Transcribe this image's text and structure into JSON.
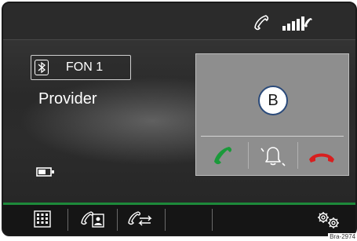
{
  "status_bar": {
    "phone_icon": "phone-handset-icon",
    "signal_icon": "signal-strength-icon"
  },
  "connection": {
    "device_label": "FON 1",
    "bluetooth_icon": "bluetooth-icon",
    "provider": "Provider",
    "battery_icon": "battery-icon"
  },
  "incoming_call": {
    "caller_initial": "B",
    "accept_icon": "accept-call-icon",
    "mute_ringtone_icon": "mute-ringtone-icon",
    "decline_icon": "decline-call-icon",
    "accept_color": "#1a9a3a",
    "decline_color": "#d81e1e"
  },
  "bottom_bar": {
    "items": [
      {
        "icon": "keypad-icon"
      },
      {
        "icon": "phonebook-icon"
      },
      {
        "icon": "call-lists-icon"
      },
      {
        "icon": "empty-slot"
      },
      {
        "icon": "settings-icon"
      }
    ],
    "accent_color": "#1d8a3a"
  },
  "figure_ref": "Bra-2974"
}
